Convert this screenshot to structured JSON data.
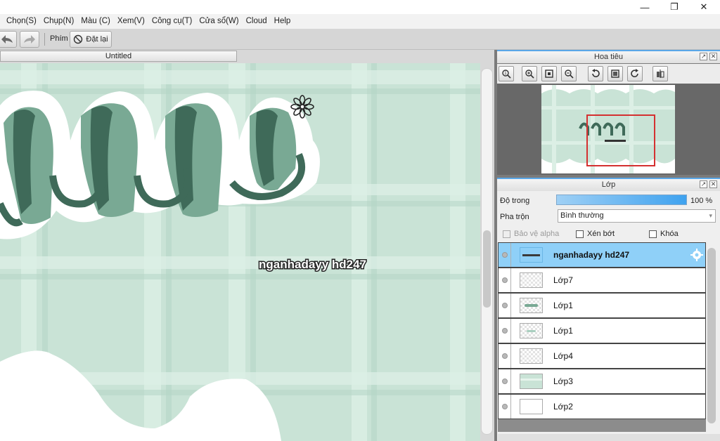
{
  "window": {
    "minimize_label": "—",
    "restore_label": "❐",
    "close_label": "✕"
  },
  "menu": {
    "items": [
      "Chọn(S)",
      "Chụp(N)",
      "Màu (C)",
      "Xem(V)",
      "Công cụ(T)",
      "Cửa sổ(W)",
      "Cloud",
      "Help"
    ]
  },
  "toolbar": {
    "undo_icon": "undo-arrow-icon",
    "redo_icon": "redo-arrow-icon",
    "shortcut_label": "Phím",
    "reset_label": "Đặt lại"
  },
  "document": {
    "tab_title": "Untitled",
    "watermark_text": "nganhadayy hd247"
  },
  "navigator": {
    "title": "Hoa tiêu",
    "buttons": [
      "zoom-fit-icon",
      "zoom-in-icon",
      "fit-window-icon",
      "zoom-out-icon",
      "rotate-left-icon",
      "reset-rotate-icon",
      "rotate-right-icon",
      "flip-icon"
    ]
  },
  "layers": {
    "title": "Lớp",
    "opacity_label": "Độ trong",
    "opacity_value": "100 %",
    "opacity_fraction": 1.0,
    "blend_label": "Pha trộn",
    "blend_value": "Bình thường",
    "protect_alpha_label": "Bảo vệ alpha",
    "clipping_label": "Xén bớt",
    "lock_label": "Khóa",
    "items": [
      {
        "name": "nganhadayy hd247",
        "selected": true
      },
      {
        "name": "Lớp7",
        "selected": false
      },
      {
        "name": "Lớp1",
        "selected": false
      },
      {
        "name": "Lớp1",
        "selected": false
      },
      {
        "name": "Lớp4",
        "selected": false
      },
      {
        "name": "Lớp3",
        "selected": false
      },
      {
        "name": "Lớp2",
        "selected": false
      }
    ]
  },
  "colors": {
    "canvas_green": "#c9e3d6",
    "stripe_light": "#dcefe5",
    "stripe_mid": "#b5d6c6",
    "ribbon_dark": "#3f6a59",
    "ribbon_mid": "#79a994",
    "selected_layer": "#8fd0f8",
    "panel_accent": "#5aa7e8"
  }
}
